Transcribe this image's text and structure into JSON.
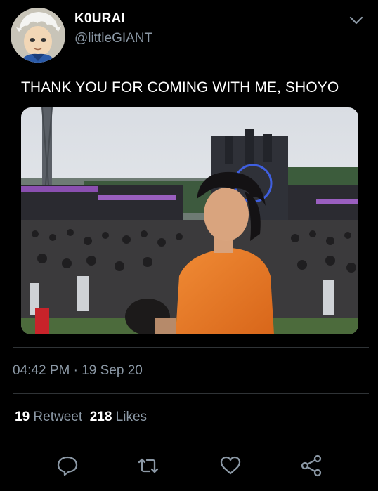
{
  "tweet": {
    "display_name": "K0URAI",
    "handle": "@littleGIANT",
    "text": "THANK YOU FOR COMING WITH ME, SHOYO",
    "time": "04:42 PM",
    "separator": "·",
    "date": "19 Sep 20",
    "retweet_count": "19",
    "retweet_label": "Retweet",
    "likes_count": "218",
    "likes_label": "Likes"
  },
  "icons": {
    "menu": "chevron-down-icon",
    "reply": "reply-icon",
    "retweet": "retweet-icon",
    "like": "heart-icon",
    "share": "share-icon"
  },
  "colors": {
    "background": "#000000",
    "text": "#ffffff",
    "secondary_text": "#8b98a5",
    "divider": "#2f3336",
    "icon": "#8b98a5"
  }
}
